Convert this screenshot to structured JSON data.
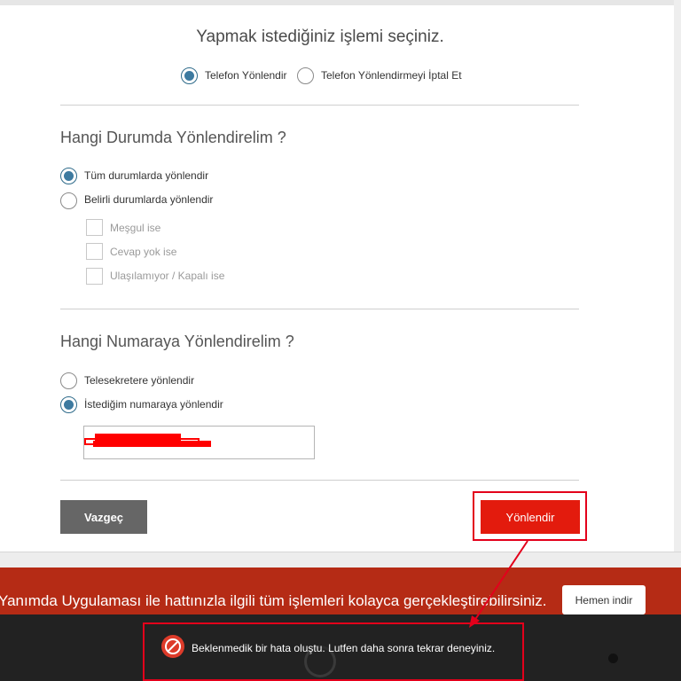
{
  "page": {
    "title": "Yapmak istediğiniz işlemi seçiniz."
  },
  "action_choice": {
    "options": [
      {
        "label": "Telefon Yönlendir",
        "selected": true
      },
      {
        "label": "Telefon Yönlendirmeyi İptal Et",
        "selected": false
      }
    ]
  },
  "condition_section": {
    "title": "Hangi Durumda Yönlendirelim ?",
    "options": [
      {
        "label": "Tüm durumlarda yönlendir",
        "selected": true
      },
      {
        "label": "Belirli durumlarda yönlendir",
        "selected": false
      }
    ],
    "sub_options": [
      {
        "label": "Meşgul ise",
        "checked": false
      },
      {
        "label": "Cevap yok ise",
        "checked": false
      },
      {
        "label": "Ulaşılamıyor / Kapalı ise",
        "checked": false
      }
    ]
  },
  "number_section": {
    "title": "Hangi Numaraya Yönlendirelim ?",
    "options": [
      {
        "label": "Telesekretere yönlendir",
        "selected": false
      },
      {
        "label": "İstediğim numaraya yönlendir",
        "selected": true
      }
    ]
  },
  "actions": {
    "cancel_label": "Vazgeç",
    "submit_label": "Yönlendir"
  },
  "promo": {
    "text": "Yanımda Uygulaması ile hattınızla ilgili tüm işlemleri kolayca gerçekleştirebilirsiniz.",
    "button_label": "Hemen indir"
  },
  "error": {
    "icon": "no-entry-icon",
    "message": "Beklenmedik bir hata oluştu. Lutfen daha sonra tekrar deneyiniz."
  },
  "colors": {
    "brand_red": "#e31b0d",
    "promo_red": "#b52b15",
    "radio_blue": "#3d7aa0",
    "annotation_red": "#e3001b"
  }
}
